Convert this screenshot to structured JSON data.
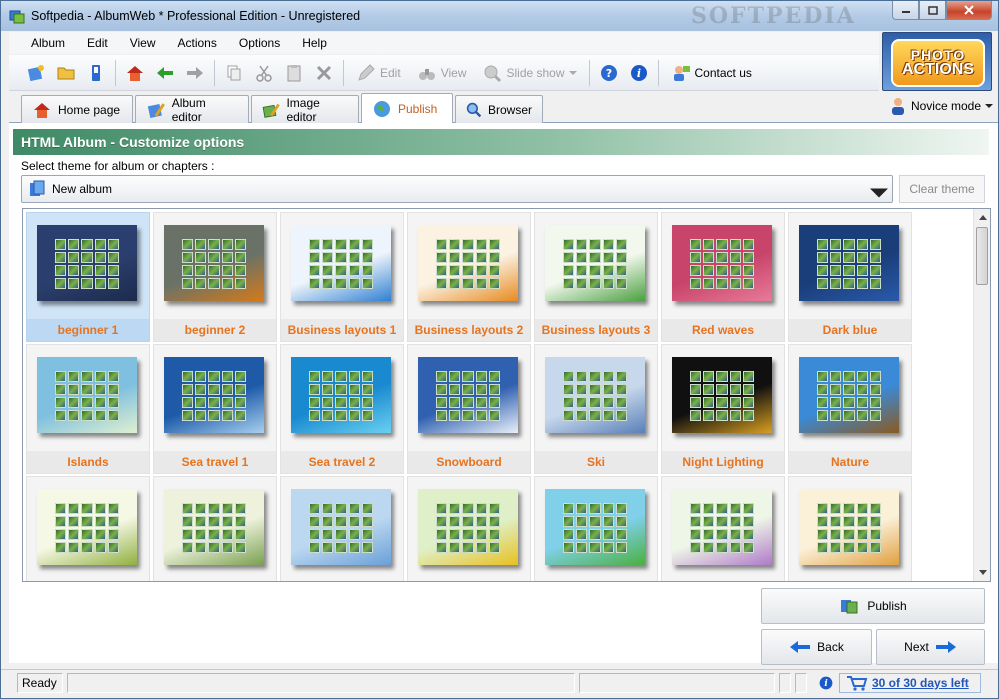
{
  "window": {
    "title": "Softpedia - AlbumWeb * Professional Edition - Unregistered",
    "watermark": "SOFTPEDIA"
  },
  "menu": [
    "Album",
    "Edit",
    "View",
    "Actions",
    "Options",
    "Help"
  ],
  "toolbar": {
    "edit_label": "Edit",
    "view_label": "View",
    "slideshow_label": "Slide show",
    "contact_label": "Contact us"
  },
  "logo": {
    "line1": "PHOTO",
    "line2": "ACTIONS"
  },
  "tabs": [
    {
      "label": "Home page"
    },
    {
      "label": "Album editor"
    },
    {
      "label": "Image editor"
    },
    {
      "label": "Publish"
    },
    {
      "label": "Browser"
    }
  ],
  "mode": {
    "label": "Novice mode"
  },
  "panel": {
    "header": "HTML Album - Customize options",
    "select_label": "Select theme for album or chapters :",
    "selected_album": "New album",
    "clear_theme": "Clear theme"
  },
  "themes": [
    {
      "label": "beginner 1",
      "bg": "#2b3f6e",
      "accent": "#1c2a4c"
    },
    {
      "label": "beginner 2",
      "bg": "#6a7268",
      "accent": "#d47a1a"
    },
    {
      "label": "Business layouts 1",
      "bg": "#eef4fb",
      "accent": "#2f80d2"
    },
    {
      "label": "Business layouts 2",
      "bg": "#fbf2e2",
      "accent": "#e88a20"
    },
    {
      "label": "Business layouts 3",
      "bg": "#f2f8ee",
      "accent": "#4aa040"
    },
    {
      "label": "Red waves",
      "bg": "#c8446a",
      "accent": "#e87a9a"
    },
    {
      "label": "Dark blue",
      "bg": "#1a3e7a",
      "accent": "#2a5aaa"
    },
    {
      "label": "Islands",
      "bg": "#7fc0e0",
      "accent": "#e0f0d0"
    },
    {
      "label": "Sea travel 1",
      "bg": "#1e5aa8",
      "accent": "#a8d0f0"
    },
    {
      "label": "Sea travel 2",
      "bg": "#1a8ad0",
      "accent": "#6ad0f0"
    },
    {
      "label": "Snowboard",
      "bg": "#3060b0",
      "accent": "#e8f0fa"
    },
    {
      "label": "Ski",
      "bg": "#c8d8ec",
      "accent": "#5a80b8"
    },
    {
      "label": "Night Lighting",
      "bg": "#101010",
      "accent": "#d8a020"
    },
    {
      "label": "Nature",
      "bg": "#3a8ad8",
      "accent": "#8a5a20"
    },
    {
      "label": "",
      "bg": "#f6f8e6",
      "accent": "#90b040"
    },
    {
      "label": "",
      "bg": "#eef2dc",
      "accent": "#7aa050"
    },
    {
      "label": "",
      "bg": "#bcd8f0",
      "accent": "#6aa0d8"
    },
    {
      "label": "",
      "bg": "#dff0c8",
      "accent": "#e8c020"
    },
    {
      "label": "",
      "bg": "#7fd0e8",
      "accent": "#4ab040"
    },
    {
      "label": "",
      "bg": "#eef6e8",
      "accent": "#b07ac8"
    },
    {
      "label": "",
      "bg": "#fbf0d8",
      "accent": "#e0a040"
    }
  ],
  "buttons": {
    "publish": "Publish",
    "back": "Back",
    "next": "Next"
  },
  "status": {
    "ready": "Ready",
    "trial": "30 of 30 days left"
  }
}
